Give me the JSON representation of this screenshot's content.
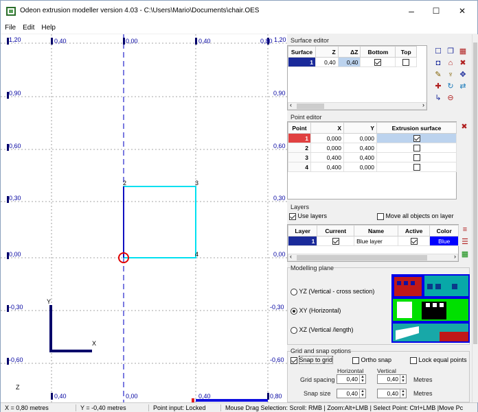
{
  "window": {
    "title": "Odeon extrusion modeller version 4.03 - C:\\Users\\Mario\\Documents\\chair.OES",
    "min": "–",
    "max": "☐",
    "close": "✕"
  },
  "menu": [
    "File",
    "Edit",
    "Help"
  ],
  "canvas": {
    "left_labels": [
      "1,20",
      "0,90",
      "0,60",
      "0,30",
      "0,00",
      "-0,30",
      "-0,60"
    ],
    "right_labels": [
      "0,90",
      "0,60",
      "0,30",
      "0,00",
      "-0,30",
      "-0,60"
    ],
    "right_top": "1,20",
    "top_labels": [
      "0,40",
      "0,00",
      "0,40",
      "0,80"
    ],
    "bottom_labels": [
      "0,40",
      "0,00",
      "0,40",
      "0,80"
    ],
    "axis_y": "Y",
    "axis_x": "X",
    "axis_z": "Z",
    "points": [
      "2",
      "3",
      "4"
    ]
  },
  "surface_editor": {
    "label": "Surface editor",
    "headers": [
      "Surface",
      "Z",
      "ΔZ",
      "Bottom",
      "Top"
    ],
    "rows": [
      {
        "surface": "1",
        "z": "0,40",
        "dz": "0,40",
        "bottom": true,
        "top": false
      }
    ]
  },
  "point_editor": {
    "label": "Point editor",
    "headers": [
      "Point",
      "X",
      "Y",
      "Extrusion surface"
    ],
    "rows": [
      {
        "point": "1",
        "x": "0,000",
        "y": "0,000",
        "ext": true
      },
      {
        "point": "2",
        "x": "0,000",
        "y": "0,400",
        "ext": false
      },
      {
        "point": "3",
        "x": "0,400",
        "y": "0,400",
        "ext": false
      },
      {
        "point": "4",
        "x": "0,400",
        "y": "0,000",
        "ext": false
      }
    ]
  },
  "layers": {
    "label": "Layers",
    "use_layers": "Use layers",
    "move_all": "Move all objects on layer",
    "headers": [
      "Layer",
      "Current",
      "Name",
      "Active",
      "Color"
    ],
    "rows": [
      {
        "layer": "1",
        "current": true,
        "name": "Blue layer",
        "active": true,
        "color": "Blue"
      }
    ]
  },
  "modelling_plane": {
    "label": "Modelling plane",
    "options": [
      "YZ (Vertical - cross section)",
      "XY (Horizontal)",
      "XZ (Vertical /length)"
    ],
    "selected": 1
  },
  "grid": {
    "label": "Grid and snap options",
    "snap_to_grid": "Snap to grid",
    "ortho_snap": "Ortho snap",
    "lock_equal": "Lock equal points",
    "horizontal": "Horizontal",
    "vertical": "Vertical",
    "grid_spacing": "Grid spacing",
    "snap_size": "Snap size",
    "gs_h": "0,40",
    "gs_v": "0,40",
    "ss_h": "0,40",
    "ss_v": "0,40",
    "metres": "Metres"
  },
  "status": [
    "X = 0,80 metres",
    "Y = -0,40 metres",
    "Point input: Locked",
    "Mouse Drag Selection: Scroll: RMB | Zoom:Alt+LMB | Select Point: Ctrl+LMB |Move Pc"
  ]
}
